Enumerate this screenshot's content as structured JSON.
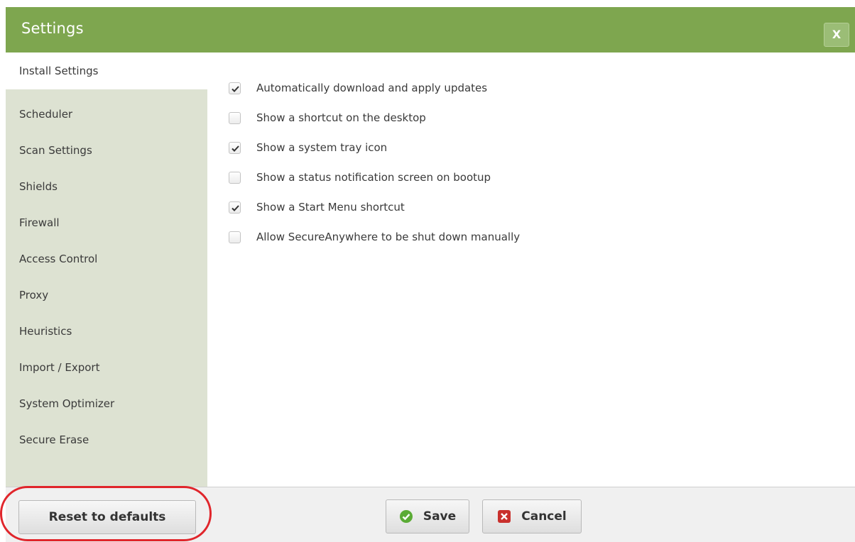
{
  "window": {
    "title": "Settings",
    "close_label": "X"
  },
  "sidebar": {
    "items": [
      {
        "label": "Install Settings",
        "active": true
      },
      {
        "label": "Scheduler"
      },
      {
        "label": "Scan Settings"
      },
      {
        "label": "Shields"
      },
      {
        "label": "Firewall"
      },
      {
        "label": "Access Control"
      },
      {
        "label": "Proxy"
      },
      {
        "label": "Heuristics"
      },
      {
        "label": "Import / Export"
      },
      {
        "label": "System Optimizer"
      },
      {
        "label": "Secure Erase"
      }
    ]
  },
  "install_settings": {
    "options": [
      {
        "label": "Automatically download and apply updates",
        "checked": true
      },
      {
        "label": "Show a shortcut on the desktop",
        "checked": false
      },
      {
        "label": "Show a system tray icon",
        "checked": true
      },
      {
        "label": "Show a status notification screen on bootup",
        "checked": false
      },
      {
        "label": "Show a Start Menu shortcut",
        "checked": true
      },
      {
        "label": "Allow SecureAnywhere to be shut down manually",
        "checked": false
      }
    ]
  },
  "footer": {
    "reset_label": "Reset to defaults",
    "save_label": "Save",
    "cancel_label": "Cancel"
  },
  "colors": {
    "titlebar": "#7ea64f",
    "sidebar": "#dde2d2",
    "highlight": "#e0252b",
    "save_icon": "#5aab35",
    "cancel_icon": "#c9302c"
  },
  "icons": {
    "save": "check-circle-icon",
    "cancel": "x-square-icon",
    "checkbox_check": "checkmark-icon"
  }
}
